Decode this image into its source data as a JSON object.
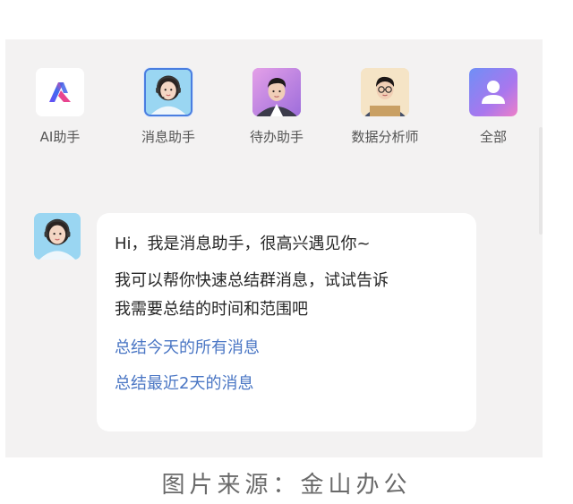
{
  "assistants": [
    {
      "label": "AI助手",
      "icon": "ai-logo-icon",
      "selected": false
    },
    {
      "label": "消息助手",
      "icon": "message-assistant-avatar",
      "selected": true
    },
    {
      "label": "待办助手",
      "icon": "todo-assistant-avatar",
      "selected": false
    },
    {
      "label": "数据分析师",
      "icon": "data-analyst-avatar",
      "selected": false
    },
    {
      "label": "全部",
      "icon": "all-user-icon",
      "selected": false
    }
  ],
  "chat": {
    "greeting": "Hi，我是消息助手，很高兴遇见你~",
    "body_line1": "我可以帮你快速总结群消息，试试告诉",
    "body_line2": "我需要总结的时间和范围吧",
    "suggestions": [
      "总结今天的所有消息",
      "总结最近2天的消息"
    ]
  },
  "caption": "图片来源：金山办公",
  "colors": {
    "panel_bg": "#f3f2f2",
    "link": "#4a76c4",
    "selected_border": "#4a7ee0"
  }
}
